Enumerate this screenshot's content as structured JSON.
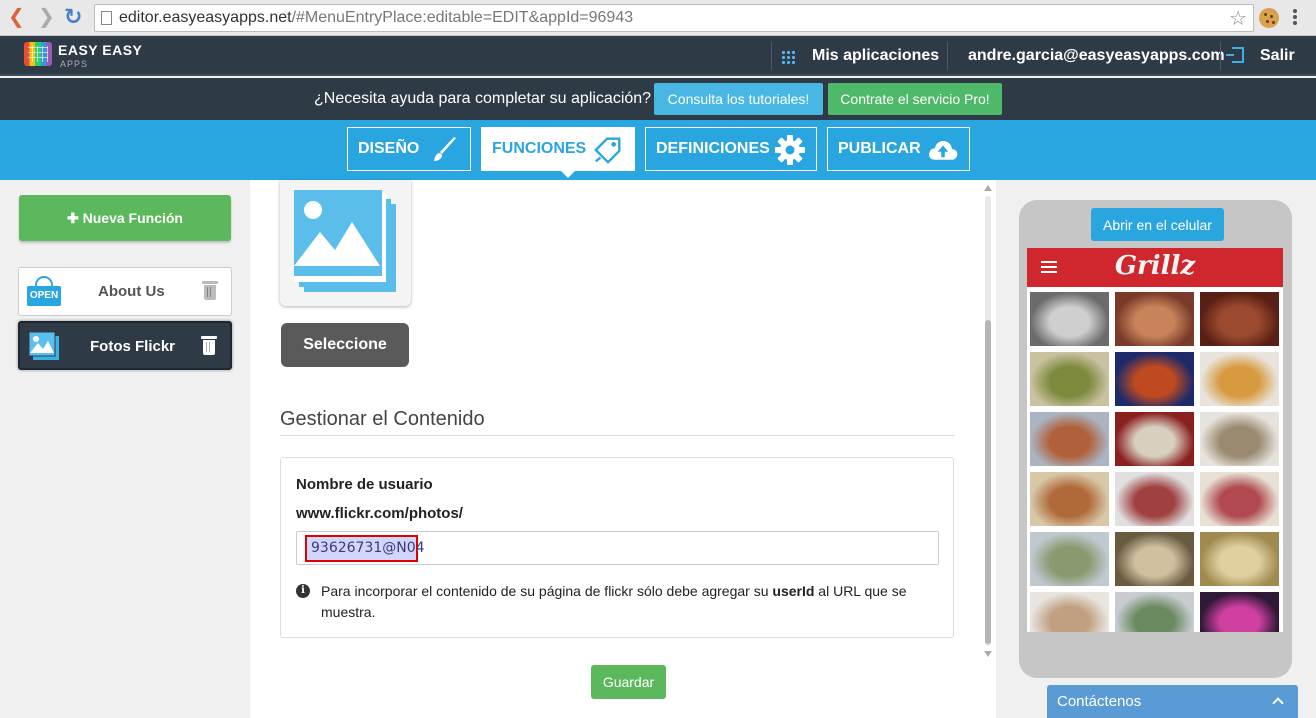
{
  "browser": {
    "url_host": "editor.easyeasyapps.net",
    "url_path": "/#MenuEntryPlace:editable=EDIT&appId=96943"
  },
  "header": {
    "logo_text": "EASY EASY",
    "logo_sub": "APPS",
    "my_apps": "Mis aplicaciones",
    "user_email": "andre.garcia@easyeasyapps.com",
    "logout": "Salir"
  },
  "helpbar": {
    "question": "¿Necesita ayuda para completar su aplicación?",
    "tutorials_btn": "Consulta los tutoriales!",
    "pro_btn": "Contrate el servicio Pro!"
  },
  "tabs": [
    {
      "label": "DISEÑO",
      "active": false
    },
    {
      "label": "FUNCIONES",
      "active": true
    },
    {
      "label": "DEFINICIONES",
      "active": false
    },
    {
      "label": "PUBLICAR",
      "active": false
    }
  ],
  "sidebar": {
    "new_function": "Nueva Función",
    "functions": [
      {
        "label": "About Us",
        "icon": "open-sign-icon",
        "selected": false
      },
      {
        "label": "Fotos Flickr",
        "icon": "photo-icon",
        "selected": true
      }
    ]
  },
  "main": {
    "select_btn": "Seleccione",
    "section_title": "Gestionar el Contenido",
    "username_label": "Nombre de usuario",
    "url_label": "www.flickr.com/photos/",
    "username_value": "93626731@N04",
    "info_pre": "Para incorporar el contenido de su página de flickr sólo debe agregar su ",
    "info_bold": "userId",
    "info_post": " al URL que se muestra.",
    "save_btn": "Guardar"
  },
  "preview": {
    "open_btn": "Abrir en el celular",
    "app_title": "Grillz"
  },
  "contact": {
    "label": "Contáctenos"
  },
  "colors": {
    "header_bg": "#2f3a47",
    "accent_blue": "#29a6e0",
    "green": "#5cb85c",
    "app_red": "#d0262e"
  }
}
